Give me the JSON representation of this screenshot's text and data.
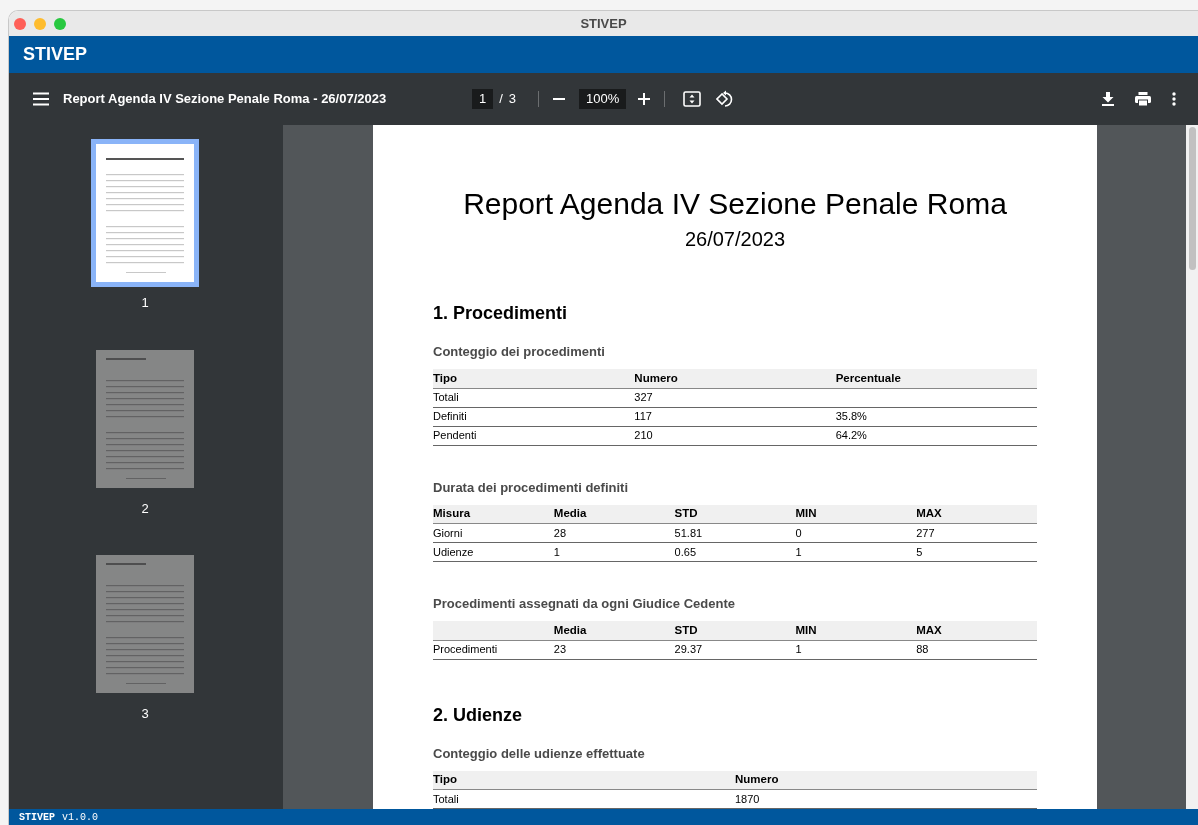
{
  "window": {
    "title": "STIVEP"
  },
  "app_bar": {
    "title": "STIVEP"
  },
  "toolbar": {
    "document_title": "Report Agenda IV Sezione Penale Roma - 26/07/2023",
    "page_current": "1",
    "page_separator": "/",
    "page_total": "3",
    "zoom": "100%"
  },
  "thumbnails": [
    {
      "label": "1",
      "selected": true
    },
    {
      "label": "2",
      "selected": false
    },
    {
      "label": "3",
      "selected": false
    }
  ],
  "document": {
    "title": "Report Agenda IV Sezione Penale Roma",
    "date": "26/07/2023",
    "sections": [
      {
        "heading": "1. Procedimenti",
        "blocks": [
          {
            "subheading": "Conteggio dei procedimenti",
            "columns": [
              "Tipo",
              "Numero",
              "Percentuale"
            ],
            "rows": [
              [
                "Totali",
                "327",
                null
              ],
              [
                "Definiti",
                "117",
                "35.8%"
              ],
              [
                "Pendenti",
                "210",
                "64.2%"
              ]
            ]
          },
          {
            "subheading": "Durata dei procedimenti definiti",
            "columns": [
              "Misura",
              "Media",
              "STD",
              "MIN",
              "MAX"
            ],
            "rows": [
              [
                "Giorni",
                "28",
                "51.81",
                "0",
                "277"
              ],
              [
                "Udienze",
                "1",
                "0.65",
                "1",
                "5"
              ]
            ]
          },
          {
            "subheading": "Procedimenti assegnati da ogni Giudice Cedente",
            "columns": [
              null,
              "Media",
              "STD",
              "MIN",
              "MAX"
            ],
            "rows": [
              [
                "Procedimenti",
                "23",
                "29.37",
                "1",
                "88"
              ]
            ]
          }
        ]
      },
      {
        "heading": "2. Udienze",
        "blocks": [
          {
            "subheading": "Conteggio delle udienze effettuate",
            "columns": [
              "Tipo",
              "Numero"
            ],
            "rows": [
              [
                "Totali",
                "1870"
              ]
            ]
          }
        ]
      }
    ]
  },
  "status_bar": {
    "app": "STIVEP",
    "version": "v1.0.0"
  }
}
